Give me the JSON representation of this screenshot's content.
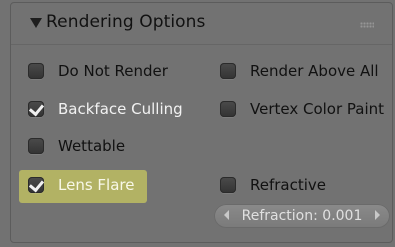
{
  "panel": {
    "title": "Rendering Options",
    "options_left": [
      {
        "label": "Do Not Render",
        "checked": false
      },
      {
        "label": "Backface Culling",
        "checked": true
      },
      {
        "label": "Wettable",
        "checked": false
      },
      {
        "label": "Lens Flare",
        "checked": true
      }
    ],
    "options_right": [
      {
        "label": "Render Above All",
        "checked": false
      },
      {
        "label": "Vertex Color Paint",
        "checked": false
      },
      {
        "label": "Refractive",
        "checked": false
      }
    ],
    "refraction": {
      "label": "Refraction: 0.001"
    }
  },
  "colors": {
    "panel_bg": "#727272",
    "checkbox_bg": "#3a3a3a",
    "highlight": "#e8e85a"
  }
}
